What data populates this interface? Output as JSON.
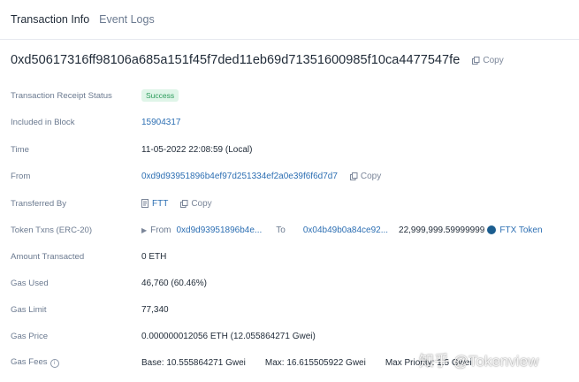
{
  "tabs": [
    {
      "label": "Transaction Info",
      "active": true
    },
    {
      "label": "Event Logs",
      "active": false
    }
  ],
  "tx_hash": "0xd50617316ff98106a685a151f45f7ded11eb69d71351600985f10ca4477547fe",
  "copy_label": "Copy",
  "fields": {
    "status": {
      "label": "Transaction Receipt Status",
      "value": "Success"
    },
    "block": {
      "label": "Included in Block",
      "value": "15904317"
    },
    "time": {
      "label": "Time",
      "value": "11-05-2022 22:08:59 (Local)"
    },
    "from": {
      "label": "From",
      "value": "0xd9d93951896b4ef97d251334ef2a0e39f6f6d7d7"
    },
    "transferred_by": {
      "label": "Transferred By",
      "value": "FTT"
    },
    "token_txns": {
      "label": "Token Txns (ERC-20)",
      "from_label": "From",
      "from_address": "0xd9d93951896b4e...",
      "to_label": "To",
      "to_address": "0x04b49b0a84ce92...",
      "amount": "22,999,999.59999999",
      "token": "FTX Token"
    },
    "amount": {
      "label": "Amount Transacted",
      "value": "0 ETH"
    },
    "gas_used": {
      "label": "Gas Used",
      "value": "46,760 (60.46%)"
    },
    "gas_limit": {
      "label": "Gas Limit",
      "value": "77,340"
    },
    "gas_price": {
      "label": "Gas Price",
      "value": "0.000000012056 ETH (12.055864271 Gwei)"
    },
    "gas_fees": {
      "label": "Gas Fees",
      "base": "Base: 10.555864271 Gwei",
      "max": "Max: 16.615505922 Gwei",
      "max_priority": "Max Priority: 1.5 Gwei"
    }
  },
  "watermark": "知乎 @Tokenview",
  "colors": {
    "link": "#2d6fb3",
    "success_bg": "#dff5e8",
    "success_text": "#2b9b5a"
  }
}
